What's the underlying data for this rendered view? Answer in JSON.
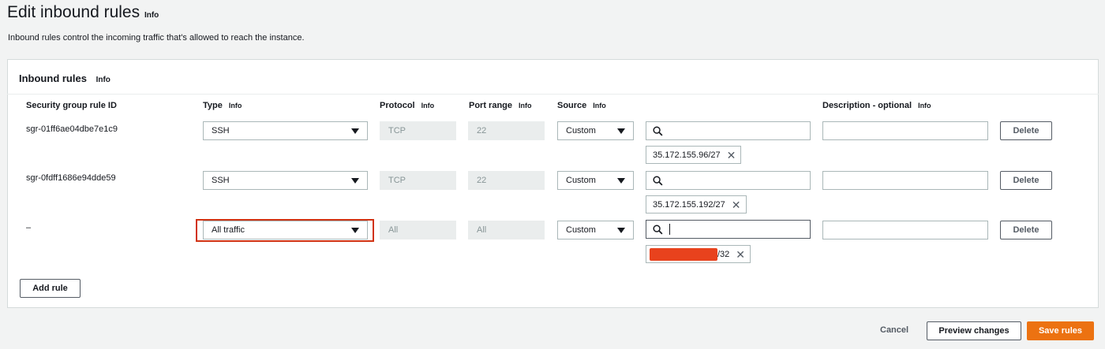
{
  "header": {
    "title": "Edit inbound rules",
    "info": "Info",
    "subtitle": "Inbound rules control the incoming traffic that's allowed to reach the instance."
  },
  "panel": {
    "title": "Inbound rules",
    "info": "Info"
  },
  "columns": {
    "rule_id": "Security group rule ID",
    "type": "Type",
    "protocol": "Protocol",
    "port_range": "Port range",
    "source": "Source",
    "description": "Description - optional",
    "info": "Info"
  },
  "rules": [
    {
      "id": "sgr-01ff6ae04dbe7e1c9",
      "type": "SSH",
      "protocol": "TCP",
      "port_range": "22",
      "source": "Custom",
      "cidr": "35.172.155.96/27",
      "delete": "Delete"
    },
    {
      "id": "sgr-0fdff1686e94dde59",
      "type": "SSH",
      "protocol": "TCP",
      "port_range": "22",
      "source": "Custom",
      "cidr": "35.172.155.192/27",
      "delete": "Delete"
    },
    {
      "id": "–",
      "type": "All traffic",
      "protocol": "All",
      "port_range": "All",
      "source": "Custom",
      "cidr": "/32",
      "delete": "Delete"
    }
  ],
  "actions": {
    "add_rule": "Add rule",
    "cancel": "Cancel",
    "preview": "Preview changes",
    "save": "Save rules"
  },
  "colors": {
    "primary": "#ec7211",
    "highlight": "#d13212",
    "redaction": "#e8421d"
  },
  "icons": {
    "search": "search-icon",
    "remove": "close-icon",
    "dropdown": "caret-down-icon"
  }
}
